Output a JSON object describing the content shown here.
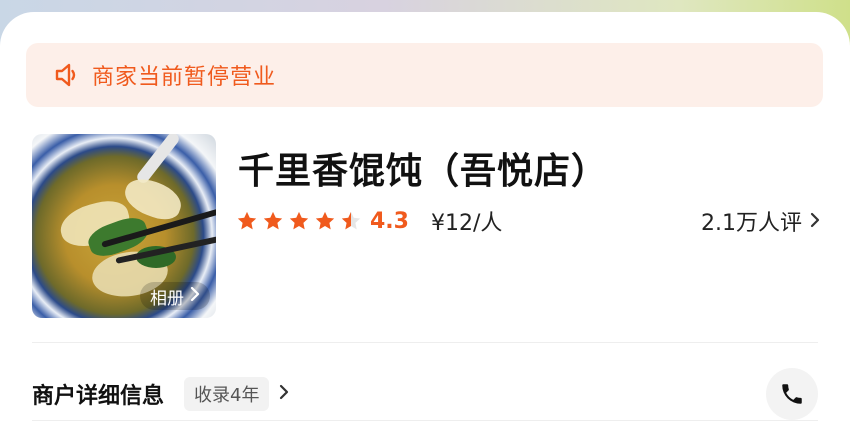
{
  "notice": {
    "icon": "speaker-icon",
    "text": "商家当前暂停营业"
  },
  "shop": {
    "name": "千里香馄饨（吾悦店）",
    "album_label": "相册",
    "rating": {
      "score": "4.3",
      "stars_value": 4.3,
      "stars_max": 5
    },
    "price": "¥12/人",
    "reviews": "2.1万人评"
  },
  "details": {
    "title": "商户详细信息",
    "badge": "收录4年",
    "phone_icon": "phone-icon"
  },
  "colors": {
    "accent": "#f05a1d",
    "notice_bg": "#fdefe9"
  }
}
